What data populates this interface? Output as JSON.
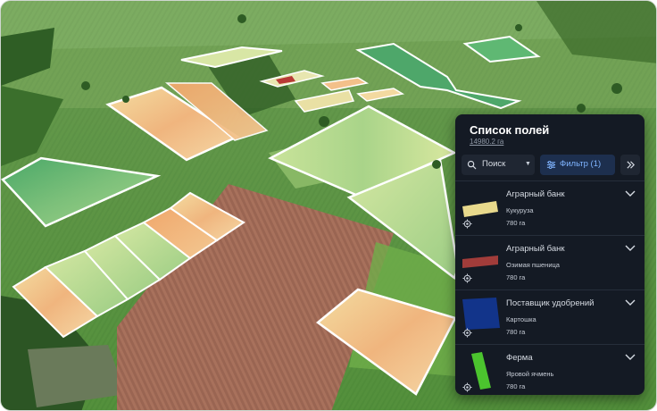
{
  "panel": {
    "title": "Список полей",
    "total_area": "14980.2 га",
    "search_label": "Поиск",
    "filter_label": "Фильтр (1)"
  },
  "fields": [
    {
      "owner": "Аграрный банк",
      "crop": "Кукуруза",
      "area": "780 га",
      "color": "#e8d98c"
    },
    {
      "owner": "Аграрный банк",
      "crop": "Озимая пшеница",
      "area": "780 га",
      "color": "#a13c3a"
    },
    {
      "owner": "Поставщик удобрений",
      "crop": "Картошка",
      "area": "780 га",
      "color": "#12348a"
    },
    {
      "owner": "Ферма",
      "crop": "Яровой ячмень",
      "area": "780 га",
      "color": "#4bc42e"
    }
  ],
  "colors": {
    "panel_bg": "#141a24",
    "accent": "#7fb4ff",
    "filter_bg": "#1d2f4e"
  }
}
